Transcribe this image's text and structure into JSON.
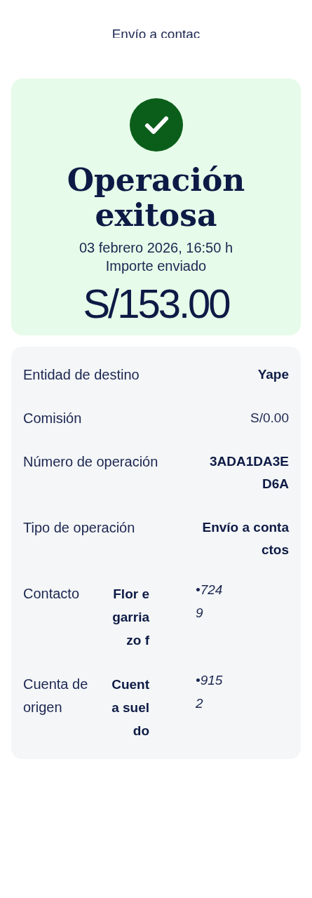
{
  "header": {
    "title": "Envío a contac"
  },
  "result": {
    "success": true,
    "title": "Operación exitosa",
    "datetime": "03 febrero 2026, 16:50 h",
    "amount_label": "Importe enviado",
    "amount": "S/153.00"
  },
  "details": [
    {
      "kind": "pair",
      "label": "Entidad de destino",
      "value": "Yape",
      "bold": true
    },
    {
      "kind": "pair",
      "label": "Comisión",
      "value": "S/0.00",
      "bold": false
    },
    {
      "kind": "pair",
      "label": "Número de operación",
      "value": "3ADA1DA3ED6A",
      "bold": true
    },
    {
      "kind": "pair",
      "label": "Tipo de operación",
      "value": "Envío a contactos",
      "bold": true
    },
    {
      "kind": "split",
      "label": "Contacto",
      "value": "Flor egarriazo f",
      "suffix": "•7249"
    },
    {
      "kind": "split",
      "label": "Cuenta de origen",
      "value": "Cuenta sueldo",
      "suffix": "•9152"
    }
  ]
}
